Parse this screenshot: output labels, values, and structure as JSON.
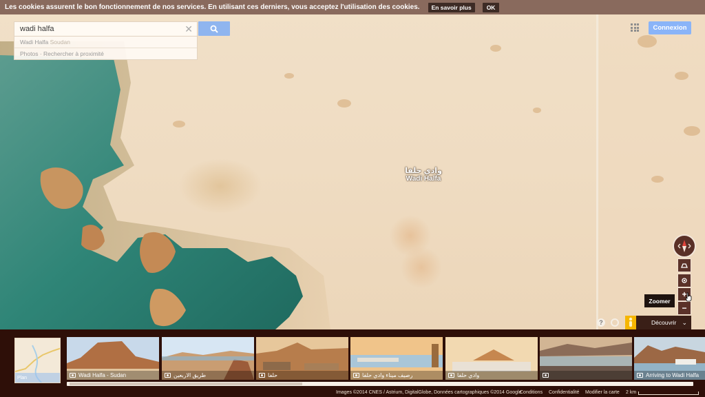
{
  "cookie_bar": {
    "message": "Les cookies assurent le bon fonctionnement de nos services. En utilisant ces derniers, vous acceptez l'utilisation des cookies.",
    "learn_more": "En savoir plus",
    "ok": "OK"
  },
  "search": {
    "value": "wadi halfa",
    "clear_icon": "close-icon",
    "button_icon": "search-icon",
    "suggestions": [
      {
        "main": "Wadi Halfa",
        "sub": "Soudan"
      },
      {
        "main": "Photos · Rechercher à proximité",
        "sub": ""
      }
    ]
  },
  "header": {
    "apps_icon": "apps-grid-icon",
    "signin": "Connexion"
  },
  "place": {
    "arabic_name": "وادي حلفا",
    "latin_name": "Wadi Halfa"
  },
  "controls": {
    "compass_icon": "compass-icon",
    "tilt_icon": "tilt-3d-icon",
    "location_icon": "my-location-icon",
    "zoom_in_icon": "zoom-in-icon",
    "zoom_out_icon": "zoom-out-icon",
    "zoom_tooltip": "Zoomer",
    "help_icon": "help-icon",
    "settings_icon": "settings-icon",
    "discover_label": "Découvrir",
    "pegman_icon": "pegman-icon"
  },
  "filmstrip": {
    "minimap_label": "Plan",
    "photos": [
      {
        "caption": "Wadi Halfa - Sudan"
      },
      {
        "caption": "طريق الاربعين"
      },
      {
        "caption": "حلفا"
      },
      {
        "caption": "رصيف ميناء وادي حلفا"
      },
      {
        "caption": "وادي حلفا"
      },
      {
        "caption": ""
      },
      {
        "caption": "Arriving to Wadi Halfa"
      }
    ]
  },
  "footer": {
    "imagery": "Images ©2014 CNES / Astrium, DigitalGlobe, Données cartographiques ©2014 Google",
    "terms": "Conditions",
    "privacy": "Confidentialité",
    "edit_map": "Modifier la carte",
    "scale": "2 km"
  },
  "colors": {
    "accent_blue": "#8ab4f8",
    "control_brown": "#5b3229",
    "strip_bg": "#2e0f08",
    "water": "#3f8d7f",
    "sand": "#efdcc2"
  }
}
